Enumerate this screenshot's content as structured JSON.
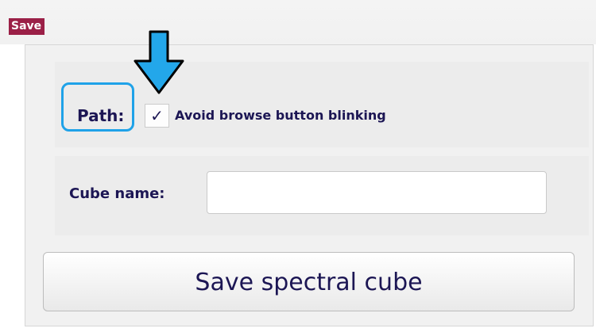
{
  "section": {
    "title": "Save"
  },
  "path": {
    "label": "Path:",
    "checkbox": {
      "checked": true,
      "mark": "✓",
      "label": "Avoid browse button blinking"
    }
  },
  "cube": {
    "label": "Cube name:",
    "value": "",
    "placeholder": ""
  },
  "actions": {
    "save_label": "Save spectral cube"
  },
  "annotations": {
    "arrow_icon": "down-arrow-icon",
    "highlight_color": "#1fa2e8",
    "arrow_color": "#23a7ea"
  },
  "colors": {
    "header_bg": "#9b2047",
    "text": "#1c1654"
  }
}
